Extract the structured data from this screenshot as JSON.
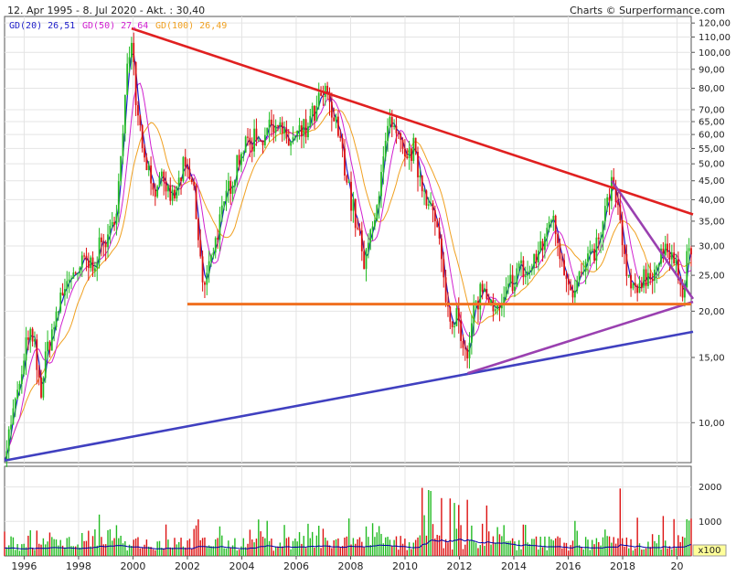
{
  "header": {
    "range_text": "12. Apr 1995 - 8. Jul 2020 - Akt. : 30,40",
    "credit_text": "Charts © Surperformance.com"
  },
  "legend": [
    {
      "label": "GD(20)",
      "value": "26,51",
      "color": "#1c1cc8"
    },
    {
      "label": "GD(50)",
      "value": "27,64",
      "color": "#d020d0"
    },
    {
      "label": "GD(100)",
      "value": "26,49",
      "color": "#f0a020"
    }
  ],
  "volume_unit": "x100",
  "colors": {
    "up": "#22bb22",
    "down": "#dd1111",
    "gd20": "#1c1cc8",
    "gd50": "#d020d0",
    "gd100": "#f0a020",
    "trend_red": "#e02020",
    "trend_blue": "#4040c0",
    "trend_purple": "#9a40b0",
    "support_orange": "#f07020",
    "volume_avg": "#0000aa"
  },
  "chart_data": {
    "type": "candlestick",
    "x_range": [
      1995.28,
      2020.52
    ],
    "x_ticks": [
      "1996",
      "1998",
      "2000",
      "2002",
      "2004",
      "2006",
      "2008",
      "2010",
      "2012",
      "2014",
      "2016",
      "2018",
      "20"
    ],
    "y_scale": "log",
    "y_range": [
      7.8,
      125
    ],
    "y_ticks": [
      "120,00",
      "110,00",
      "100,00",
      "90,00",
      "80,00",
      "70,00",
      "65,00",
      "60,00",
      "55,00",
      "50,00",
      "45,00",
      "40,00",
      "35,00",
      "30,00",
      "25,00",
      "20,00",
      "15,00",
      "10,00"
    ],
    "current_value": "30,40",
    "price_path": [
      [
        1995.28,
        8.2
      ],
      [
        1995.7,
        11.5
      ],
      [
        1996.0,
        14.5
      ],
      [
        1996.15,
        17.5
      ],
      [
        1996.4,
        15.5
      ],
      [
        1996.6,
        12.0
      ],
      [
        1996.8,
        15.0
      ],
      [
        1997.0,
        17.5
      ],
      [
        1997.3,
        21.0
      ],
      [
        1997.6,
        25.0
      ],
      [
        1997.9,
        24.0
      ],
      [
        1998.2,
        28.0
      ],
      [
        1998.5,
        26.0
      ],
      [
        1998.8,
        31.0
      ],
      [
        1999.1,
        30.0
      ],
      [
        1999.4,
        40.0
      ],
      [
        1999.6,
        55.0
      ],
      [
        1999.8,
        95.0
      ],
      [
        1999.95,
        110.0
      ],
      [
        2000.1,
        75.0
      ],
      [
        2000.3,
        60.0
      ],
      [
        2000.5,
        50.0
      ],
      [
        2000.8,
        42.0
      ],
      [
        2001.1,
        44.0
      ],
      [
        2001.5,
        40.0
      ],
      [
        2001.8,
        48.0
      ],
      [
        2002.0,
        47.0
      ],
      [
        2002.2,
        44.0
      ],
      [
        2002.4,
        32.0
      ],
      [
        2002.6,
        22.0
      ],
      [
        2002.8,
        28.0
      ],
      [
        2003.1,
        32.0
      ],
      [
        2003.4,
        40.0
      ],
      [
        2003.7,
        48.0
      ],
      [
        2004.0,
        55.0
      ],
      [
        2004.4,
        58.0
      ],
      [
        2004.8,
        60.0
      ],
      [
        2005.2,
        67.0
      ],
      [
        2005.6,
        57.0
      ],
      [
        2006.0,
        58.0
      ],
      [
        2006.4,
        62.0
      ],
      [
        2006.8,
        72.0
      ],
      [
        2007.1,
        78.0
      ],
      [
        2007.4,
        65.0
      ],
      [
        2007.7,
        55.0
      ],
      [
        2008.0,
        40.0
      ],
      [
        2008.3,
        33.0
      ],
      [
        2008.5,
        26.0
      ],
      [
        2008.8,
        34.0
      ],
      [
        2009.1,
        45.0
      ],
      [
        2009.4,
        65.0
      ],
      [
        2009.7,
        58.0
      ],
      [
        2010.0,
        52.0
      ],
      [
        2010.3,
        55.0
      ],
      [
        2010.6,
        45.0
      ],
      [
        2010.9,
        40.0
      ],
      [
        2011.2,
        32.0
      ],
      [
        2011.5,
        22.0
      ],
      [
        2011.7,
        18.0
      ],
      [
        2011.9,
        21.0
      ],
      [
        2012.1,
        17.0
      ],
      [
        2012.3,
        14.5
      ],
      [
        2012.5,
        20.0
      ],
      [
        2012.8,
        23.0
      ],
      [
        2013.0,
        22.0
      ],
      [
        2013.3,
        19.0
      ],
      [
        2013.6,
        21.0
      ],
      [
        2013.9,
        24.0
      ],
      [
        2014.2,
        26.0
      ],
      [
        2014.5,
        25.0
      ],
      [
        2014.8,
        28.0
      ],
      [
        2015.1,
        30.0
      ],
      [
        2015.3,
        37.0
      ],
      [
        2015.6,
        32.0
      ],
      [
        2015.9,
        25.0
      ],
      [
        2016.2,
        23.0
      ],
      [
        2016.5,
        25.0
      ],
      [
        2016.8,
        28.0
      ],
      [
        2017.1,
        30.0
      ],
      [
        2017.4,
        38.0
      ],
      [
        2017.6,
        45.0
      ],
      [
        2017.8,
        38.0
      ],
      [
        2018.0,
        30.0
      ],
      [
        2018.3,
        22.0
      ],
      [
        2018.6,
        24.0
      ],
      [
        2018.9,
        25.0
      ],
      [
        2019.2,
        26.0
      ],
      [
        2019.5,
        28.0
      ],
      [
        2019.8,
        30.0
      ],
      [
        2020.0,
        27.0
      ],
      [
        2020.2,
        21.0
      ],
      [
        2020.35,
        27.0
      ],
      [
        2020.52,
        30.4
      ]
    ],
    "trendlines": [
      {
        "color_key": "trend_red",
        "from": [
          1999.95,
          116.0
        ],
        "to": [
          2020.52,
          36.5
        ]
      },
      {
        "color_key": "trend_blue",
        "from": [
          1995.28,
          7.9
        ],
        "to": [
          2020.52,
          17.6
        ]
      },
      {
        "color_key": "trend_purple",
        "from": [
          2012.3,
          13.6
        ],
        "to": [
          2020.52,
          21.2
        ]
      },
      {
        "color_key": "trend_purple",
        "from": [
          2017.6,
          45.0
        ],
        "to": [
          2020.52,
          21.6
        ]
      },
      {
        "color_key": "support_orange",
        "from": [
          2002.0,
          20.9
        ],
        "to": [
          2020.52,
          20.9
        ]
      }
    ],
    "volume": {
      "y_ticks": [
        "2000",
        "1000"
      ],
      "y_max": 2600
    }
  }
}
